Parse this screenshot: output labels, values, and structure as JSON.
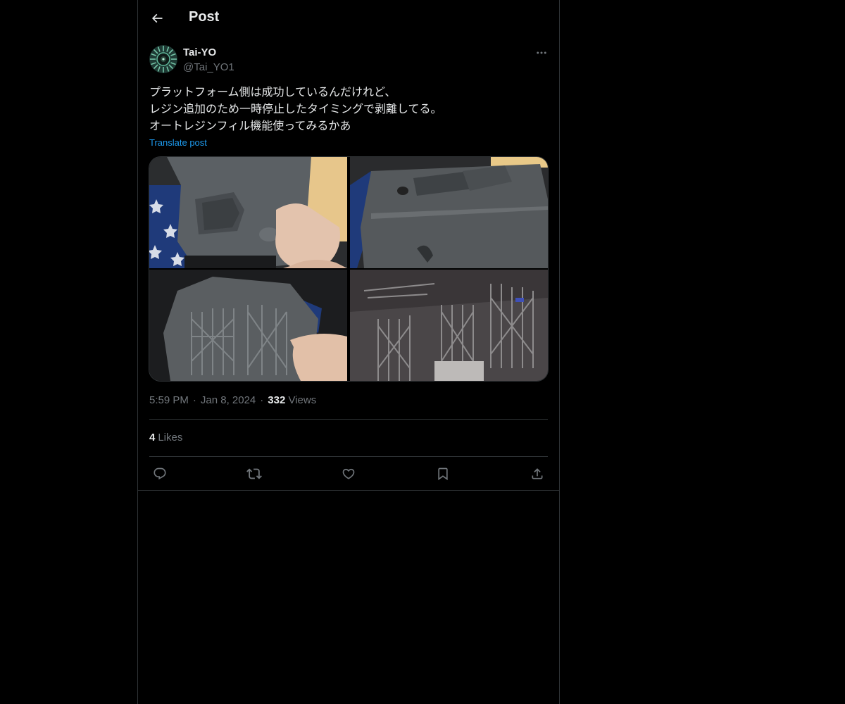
{
  "header": {
    "title": "Post"
  },
  "author": {
    "display_name": "Tai-YO",
    "handle": "@Tai_YO1"
  },
  "post": {
    "lines": [
      "プラットフォーム側は成功しているんだけれど、",
      "レジン追加のため一時停止したタイミングで剥離してる。",
      "オートレジンフィル機能使ってみるかあ"
    ],
    "translate_label": "Translate post",
    "time": "5:59 PM",
    "date": "Jan 8, 2024",
    "views_count": "332",
    "views_label": "Views",
    "likes_count": "4",
    "likes_label": "Likes"
  },
  "icons": {
    "back": "arrow-left-icon",
    "more": "more-horizontal-icon",
    "reply": "reply-icon",
    "repost": "repost-icon",
    "like": "heart-icon",
    "bookmark": "bookmark-icon",
    "share": "share-icon"
  },
  "colors": {
    "background": "#000000",
    "text": "#e7e9ea",
    "secondary": "#71767b",
    "link": "#1d9bf0",
    "border": "#2f3336"
  }
}
